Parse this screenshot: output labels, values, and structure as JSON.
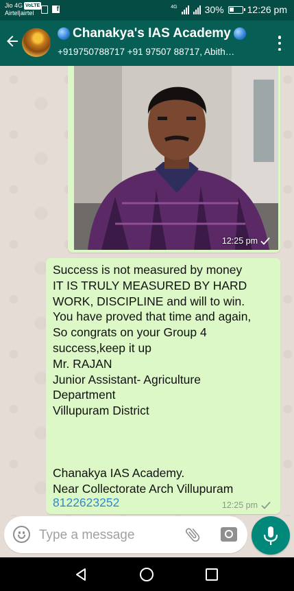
{
  "status_bar": {
    "carrier_1": "Jio 4G",
    "volte_badge": "VoLTE",
    "carrier_2": "Airtel|airtel",
    "network_label": "4G",
    "battery": "30%",
    "time": "12:26 pm"
  },
  "header": {
    "title": "Chanakya's IAS Academy",
    "subtitle": "+919750788717 +91 97507 88717, Abith…",
    "back_icon": "arrow-left-icon",
    "menu_icon": "more-vertical-icon"
  },
  "messages": [
    {
      "type": "image",
      "time": "12:25 pm",
      "status_icon": "single-check-icon"
    },
    {
      "type": "text",
      "text": "Success is not measured by money\nIT IS TRULY MEASURED BY HARD\nWORK, DISCIPLINE and will to win.\nYou have proved that time and again,\nSo congrats on your Group 4\nsuccess,keep it up\nMr. RAJAN\nJunior Assistant- Agriculture\nDepartment\nVillupuram District\n\n\n\nChanakya IAS Academy.\nNear Collectorate Arch Villupuram",
      "link": "8122623252",
      "time": "12:25 pm",
      "status_icon": "single-check-icon"
    }
  ],
  "composer": {
    "placeholder": "Type a message",
    "emoji_icon": "emoji-icon",
    "attach_icon": "paperclip-icon",
    "camera_icon": "camera-icon",
    "mic_icon": "microphone-icon"
  },
  "colors": {
    "header": "#075e54",
    "status_bar": "#054d44",
    "outgoing_bubble": "#dcf8c6",
    "link": "#2e8ac9",
    "mic_button": "#00897b"
  }
}
